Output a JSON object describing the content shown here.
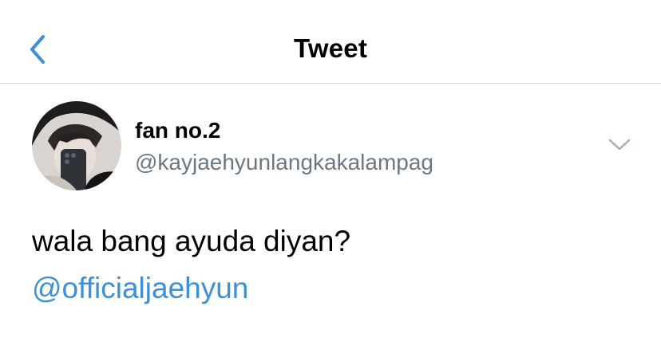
{
  "header": {
    "title": "Tweet",
    "back_icon": "chevron-left-icon"
  },
  "tweet": {
    "author_name": "fan no.2",
    "author_handle": "@kayjaehyunlangkakalampag",
    "text": "wala bang ayuda diyan?",
    "mention": "@officialjaehyun",
    "menu_icon": "chevron-down-icon"
  },
  "colors": {
    "accent": "#3d8fd6",
    "secondary_text": "#6b7883",
    "divider": "#d8d8dc"
  }
}
